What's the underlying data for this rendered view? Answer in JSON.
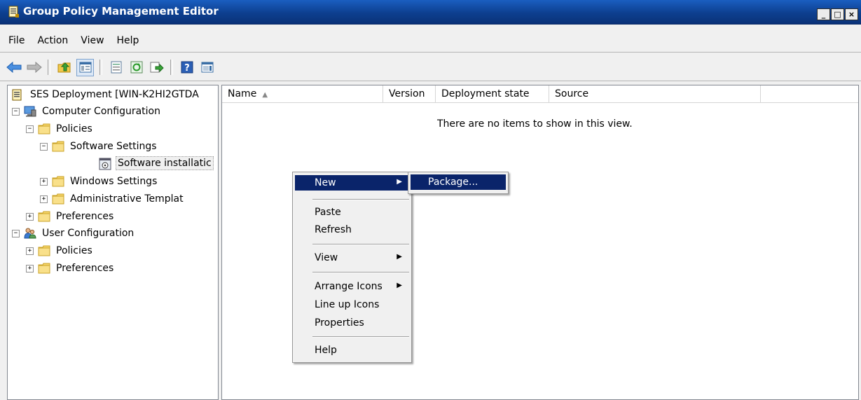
{
  "window": {
    "title": "Group Policy Management Editor",
    "caption_minimize": "_",
    "caption_maximize": "□",
    "caption_close": "×"
  },
  "menubar": {
    "items": [
      "File",
      "Action",
      "View",
      "Help"
    ]
  },
  "toolbar": {
    "icons": [
      "back-arrow-icon",
      "forward-arrow-icon",
      "up-folder-icon",
      "show-hide-tree-icon",
      "properties-icon",
      "refresh-icon",
      "export-list-icon",
      "help-icon",
      "show-action-pane-icon"
    ]
  },
  "tree": {
    "root": "SES Deployment [WIN-K2HI2GTDA",
    "computer_configuration": "Computer Configuration",
    "policies": "Policies",
    "software_settings": "Software Settings",
    "software_installation": "Software installatic",
    "windows_settings": "Windows Settings",
    "administrative_templates": "Administrative Templat",
    "preferences": "Preferences",
    "user_configuration": "User Configuration",
    "user_policies": "Policies",
    "user_preferences": "Preferences",
    "expanded_glyph": "−",
    "collapsed_glyph": "+"
  },
  "list": {
    "columns": [
      "Name",
      "Version",
      "Deployment state",
      "Source"
    ],
    "sort_indicator": "▲",
    "empty_message": "There are no items to show in this view."
  },
  "context_menu": {
    "new": "New",
    "paste": "Paste",
    "refresh": "Refresh",
    "view": "View",
    "arrange_icons": "Arrange Icons",
    "line_up_icons": "Line up Icons",
    "properties": "Properties",
    "help": "Help",
    "submenu_arrow": "▶"
  },
  "submenu": {
    "package": "Package..."
  },
  "colors": {
    "titlebar": "#0d3f8f",
    "menu_highlight": "#0a246a",
    "folder": "#f0c84a"
  }
}
